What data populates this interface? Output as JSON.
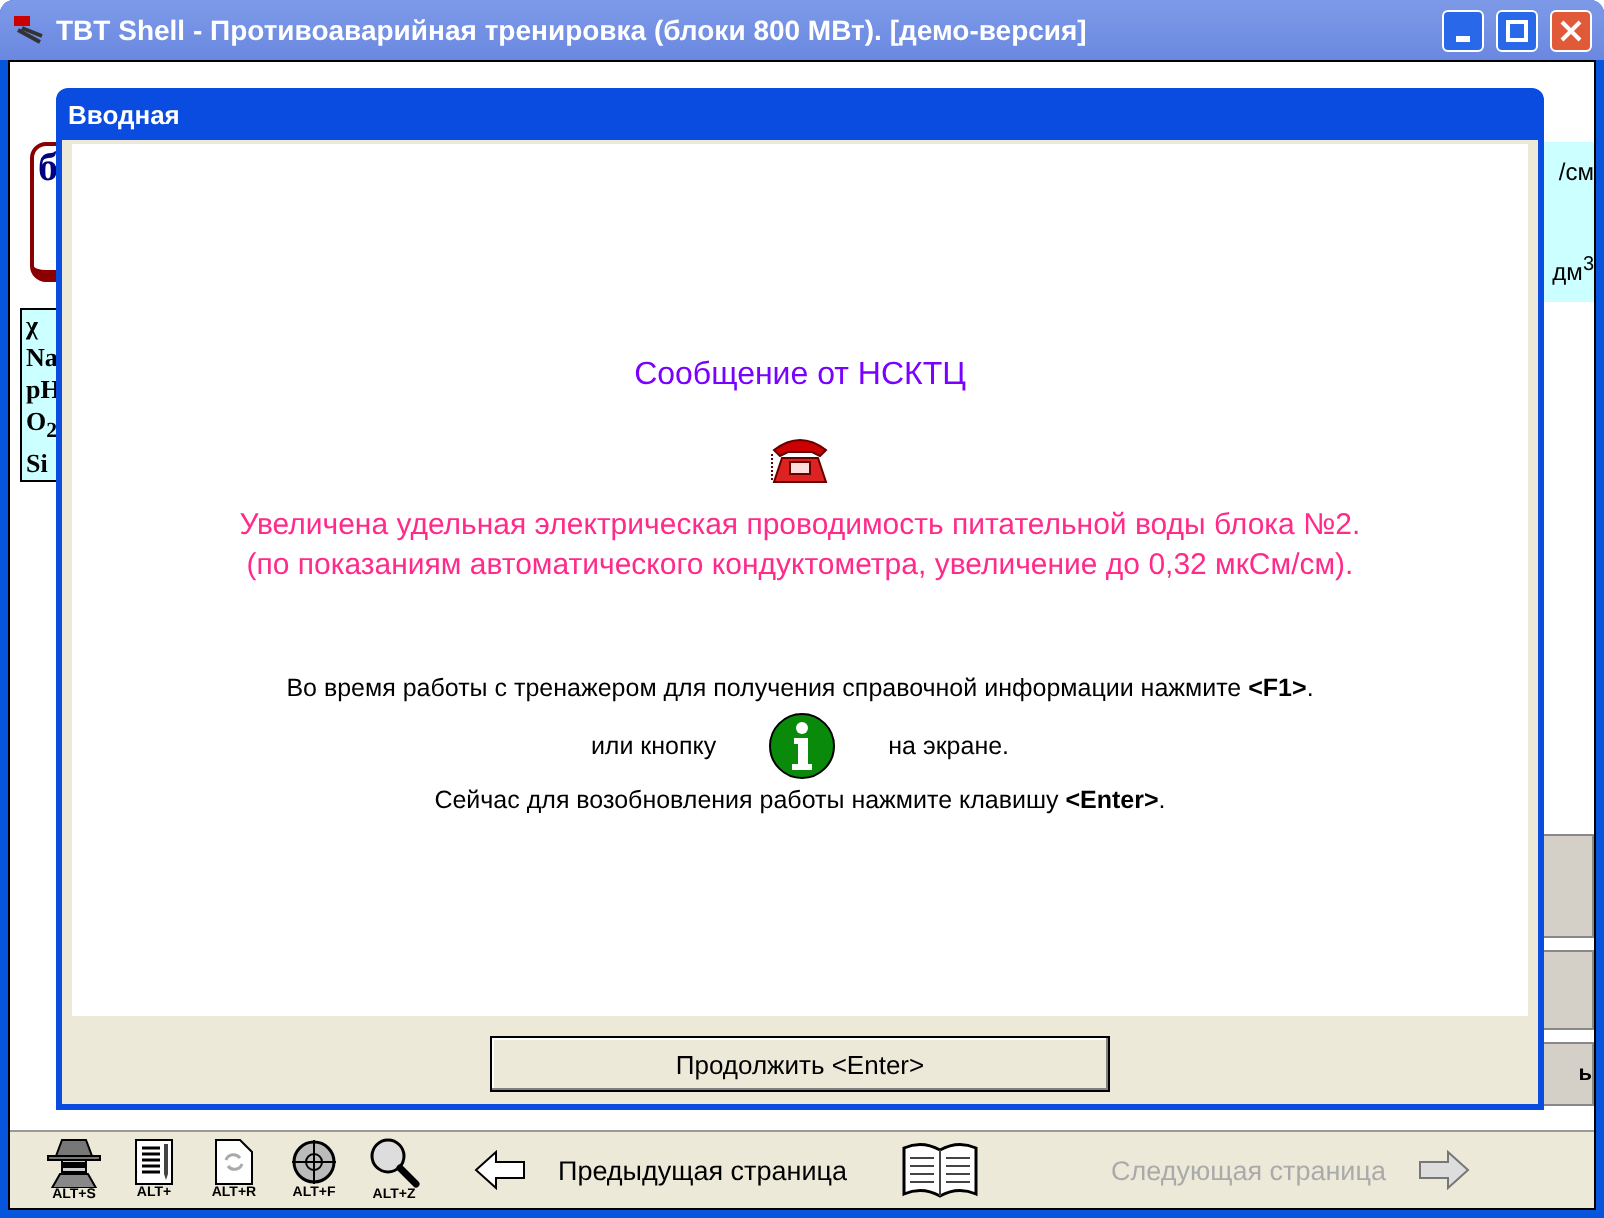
{
  "window": {
    "title": "TBT Shell - Противоаварийная тренировка (блоки 800 МВт). [демо-версия]"
  },
  "background": {
    "left_label": "б",
    "left_list": [
      "χ",
      "Na",
      "pH",
      "O$_{2}$",
      "Si"
    ],
    "right_labels": [
      "/см",
      "дм$^{3}$"
    ],
    "right_button_text": "ь"
  },
  "dialog": {
    "title": "Вводная",
    "heading": "Сообщение от НСКТЦ",
    "message": [
      "Увеличена удельная электрическая проводимость питательной воды блока №2.",
      "(по показаниям автоматического кондуктометра, увеличение до 0,32 мкСм/см)."
    ],
    "instruction": "Во время работы с тренажером для получения справочной информации нажмите **<F1>**.",
    "help_before": "или кнопку",
    "help_after": "на экране.",
    "resume": "Сейчас для возобновления работы нажмите клавишу **<Enter>**.",
    "button": "Продолжить <Enter>"
  },
  "toolbar": {
    "tools": [
      {
        "kind": "agent",
        "shortcut": "ALT+S"
      },
      {
        "kind": "document",
        "shortcut": "ALT+"
      },
      {
        "kind": "page-refresh",
        "shortcut": "ALT+R"
      },
      {
        "kind": "target",
        "shortcut": "ALT+F"
      },
      {
        "kind": "magnifier",
        "shortcut": "ALT+Z"
      }
    ],
    "prev": {
      "label": "Предыдущая страница",
      "disabled": false
    },
    "next": {
      "label": "Следующая страница",
      "disabled": true
    }
  }
}
